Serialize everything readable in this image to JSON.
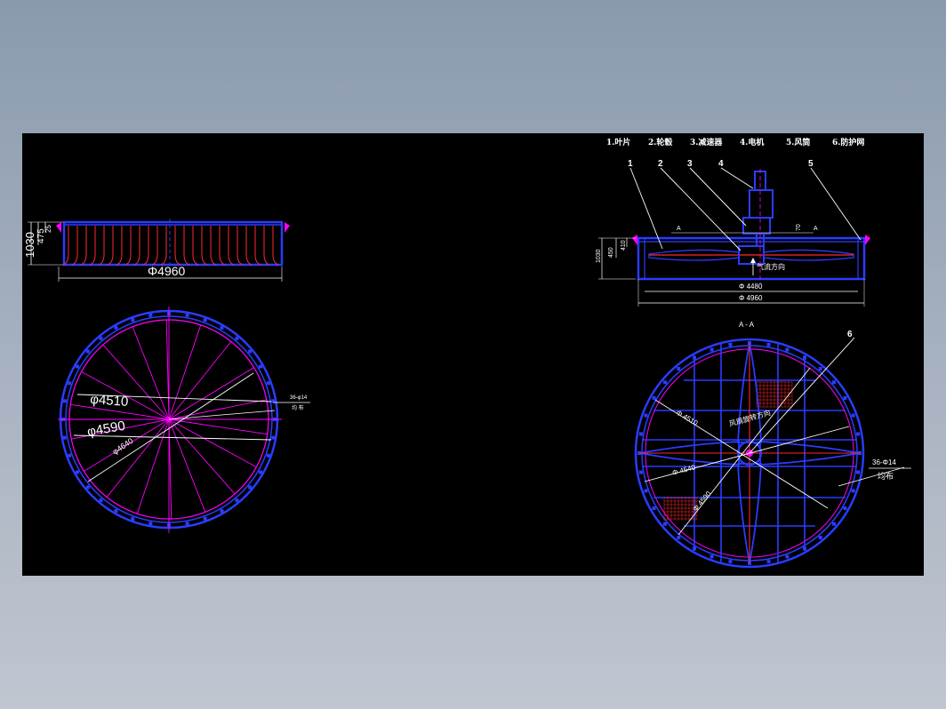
{
  "colors": {
    "background": "#000000",
    "outline": "#2a3cff",
    "accent": "#ff00ff",
    "blade": "#ff2a2a",
    "dimension": "#ffffff"
  },
  "parts_legend": [
    "1.叶片",
    "2.轮毂",
    "3.减速器",
    "4.电机",
    "5.风筒",
    "6.防护网"
  ],
  "callouts": [
    "1",
    "2",
    "3",
    "4",
    "5",
    "6"
  ],
  "left_elevation": {
    "dim_overall_height": "1030",
    "dim_inner_height": "475",
    "dim_top": "25",
    "dim_width": "Φ4960"
  },
  "left_plan": {
    "dim_outer": "φ4590",
    "dim_inner": "φ4510",
    "dim_bolt_circle": "φ4640",
    "hole_note_top": "36-φ14",
    "hole_note_bottom": "均  布"
  },
  "right_elevation": {
    "section_mark_left": "A",
    "section_mark_right": "A",
    "dim_overall_height": "1030",
    "dim_inner_height": "450",
    "dim_rim": "410",
    "dim_motor": "70",
    "airflow_label": "气流方向",
    "dim_inner_width": "Φ 4480",
    "dim_outer_width": "Φ 4960"
  },
  "right_plan": {
    "section_title": "A - A",
    "rotation_label": "风扇旋转方向",
    "dim_1": "Φ 4510",
    "dim_2": "Φ 4540",
    "dim_3": "Φ 4590",
    "hole_note_top": "36-Φ14",
    "hole_note_bottom": "均布"
  }
}
